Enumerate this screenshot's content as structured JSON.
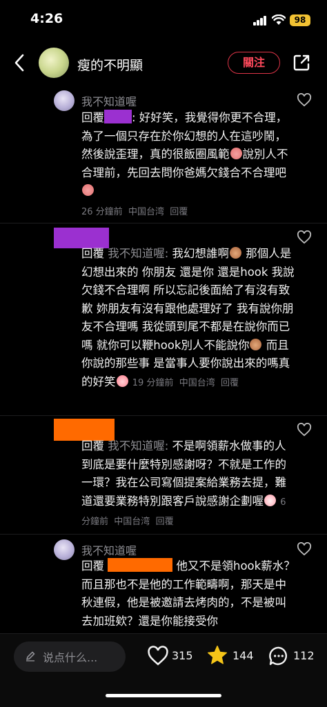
{
  "status": {
    "time": "4:26",
    "battery": "98"
  },
  "header": {
    "title": "瘦的不明顯",
    "follow_label": "關注"
  },
  "comments": [
    {
      "username": "我不知道喔",
      "reply_prefix": "回覆",
      "text_1": ": 好好笑，我覺得你更不合理，為了一個只存在於你幻想的人在這吵鬧，然後說歪理，真的很飯圈風範",
      "text_2": "說別人不合理前，先回去問你爸媽欠錢合不合理吧",
      "time": "26 分鐘前",
      "location": "中国台湾",
      "reply_label": "回覆"
    },
    {
      "reply_prefix": "回覆",
      "reply_to": "我不知道喔:",
      "text_1": " 我幻想誰啊",
      "text_2": " 那個人是幻想出來的 你朋友 還是你 還是hook 我說欠錢不合理啊 所以忘記後面給了有沒有致歉 妳朋友有沒有跟他處理好了 我有說你朋友不合理嗎 我從頭到尾不都是在說你而已嗎 就你可以鞭hook別人不能說你",
      "text_3": " 而且你說的那些事 是當事人要你說出來的嗎真的好笑",
      "time": "19 分鐘前",
      "location": "中国台湾",
      "reply_label": "回覆"
    },
    {
      "reply_prefix": "回覆",
      "reply_to": "我不知道喔:",
      "text_1": " 不是啊領薪水做事的人到底是要什麼特別感謝呀？不就是工作的一環？我在公司寫個提案給業務去提，難道還要業務特別跟客戶說感謝企劃喔",
      "time": "6 分鐘前",
      "location": "中国台湾",
      "reply_label": "回覆"
    },
    {
      "username": "我不知道喔",
      "reply_prefix": "回覆",
      "text_1": " 他又不是領hook薪水？而且那也不是他的工作範疇啊，那天是中秋連假，他是被邀請去烤肉的，不是被叫去加班欸？還是你能接受你"
    }
  ],
  "bottom": {
    "input_placeholder": "说点什么...",
    "likes": "315",
    "favorites": "144",
    "comments_count": "112"
  },
  "colors": {
    "follow_red": "#e03548",
    "redact_purple": "#9b30d0",
    "redact_orange": "#ff6a00",
    "star": "#f5c518"
  },
  "icons": [
    "back-chevron-icon",
    "share-icon",
    "heart-icon",
    "star-icon",
    "comment-bubble-icon",
    "pencil-icon"
  ]
}
